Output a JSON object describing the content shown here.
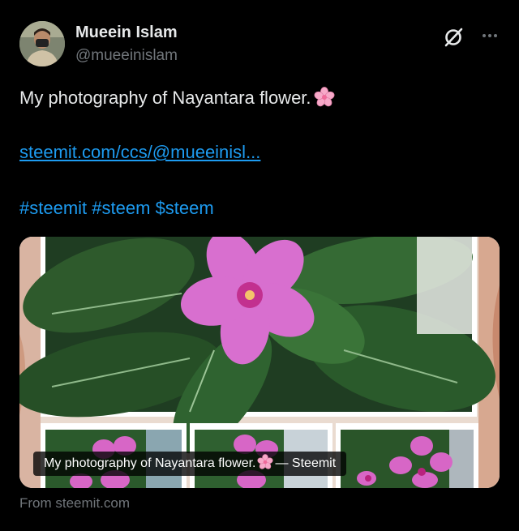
{
  "author": {
    "display_name": "Mueein Islam",
    "handle": "@mueeinislam"
  },
  "tweet": {
    "text": "My photography of Nayantara flower.",
    "text_emoji": "cherry-blossom-emoji",
    "link": "steemit.com/ccs/@mueeinisl...",
    "hashtags": [
      "#steemit",
      "#steem",
      "$steem"
    ]
  },
  "card": {
    "caption_prefix": "My photography of Nayantara flower.",
    "caption_suffix": "— Steemit",
    "source": "From steemit.com"
  },
  "icons": {
    "grok": "grok-icon",
    "more": "more-icon"
  },
  "colors": {
    "background": "#000000",
    "text": "#e7e9ea",
    "secondary_text": "#71767b",
    "link": "#1d9bf0",
    "flower_pink": "#d85fc4"
  }
}
